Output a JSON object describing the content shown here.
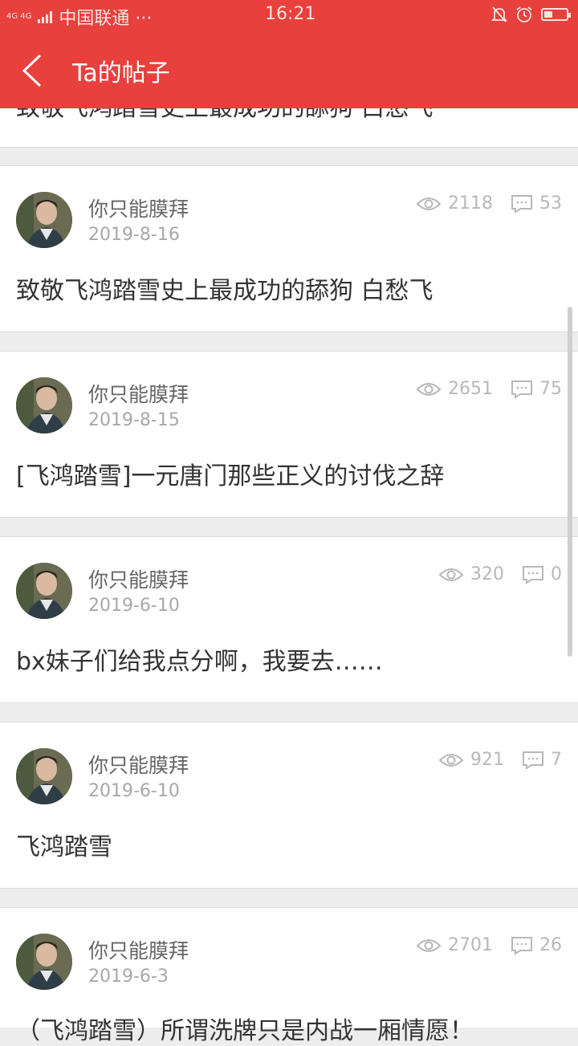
{
  "status_bar": {
    "network": "4G 4G",
    "carrier": "中国联通 ···",
    "time": "16:21"
  },
  "header": {
    "title": "Ta的帖子"
  },
  "colors": {
    "accent": "#e8403d",
    "background": "#ededed"
  },
  "partial_top_post": {
    "title": "致敬飞鸿踏雪史上最成功的舔狗 白愁飞"
  },
  "posts": [
    {
      "author": "你只能膜拜",
      "date": "2019-8-16",
      "views": "2118",
      "comments": "53",
      "title": "致敬飞鸿踏雪史上最成功的舔狗 白愁飞"
    },
    {
      "author": "你只能膜拜",
      "date": "2019-8-15",
      "views": "2651",
      "comments": "75",
      "title": "[飞鸿踏雪]一元唐门那些正义的讨伐之辞"
    },
    {
      "author": "你只能膜拜",
      "date": "2019-6-10",
      "views": "320",
      "comments": "0",
      "title": "bx妹子们给我点分啊，我要去……"
    },
    {
      "author": "你只能膜拜",
      "date": "2019-6-10",
      "views": "921",
      "comments": "7",
      "title": "飞鸿踏雪"
    },
    {
      "author": "你只能膜拜",
      "date": "2019-6-3",
      "views": "2701",
      "comments": "26",
      "title": "（飞鸿踏雪）所谓洗牌只是内战一厢情愿！"
    }
  ]
}
